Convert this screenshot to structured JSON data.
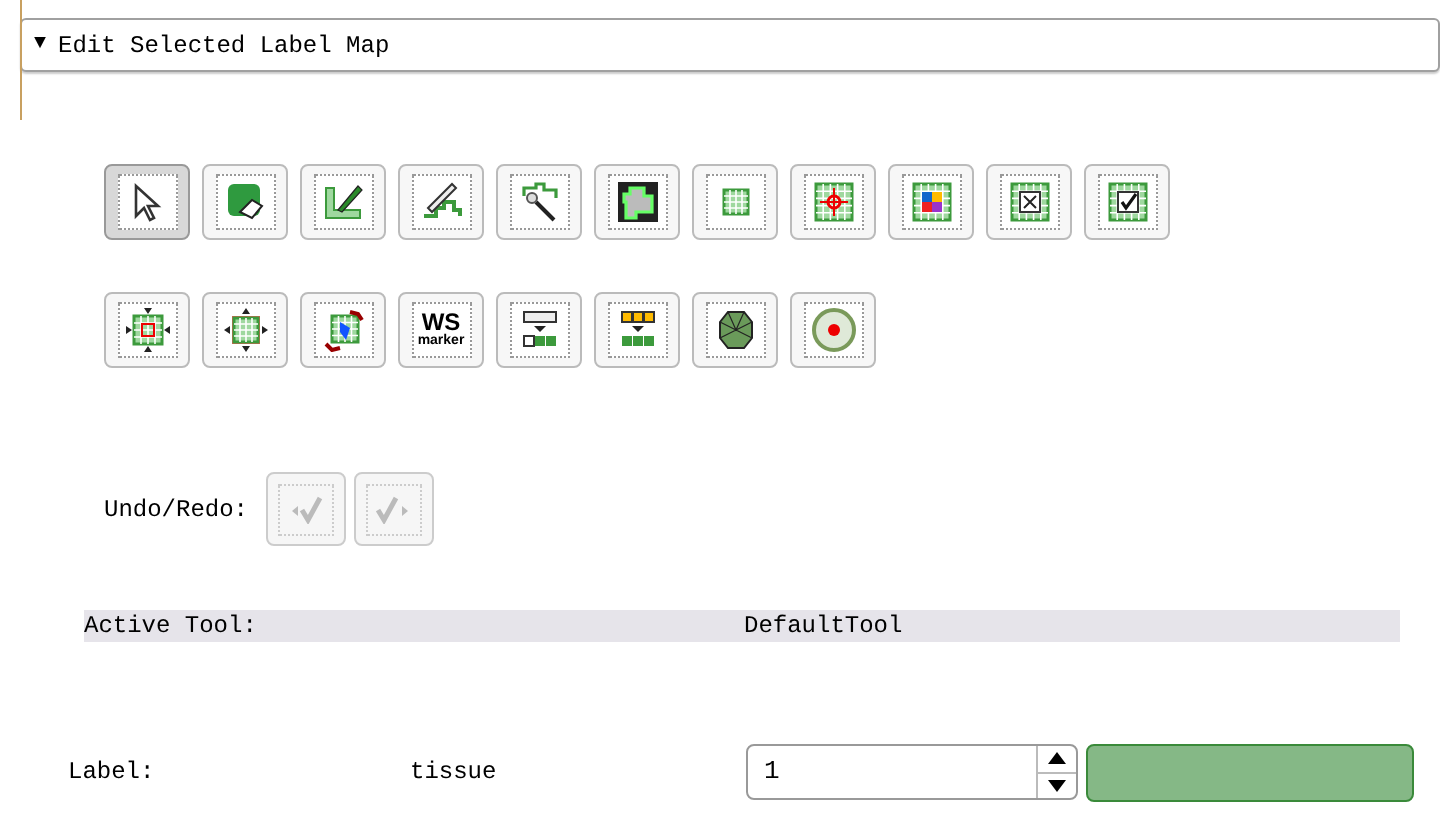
{
  "section": {
    "title": "Edit Selected Label Map",
    "expanded": true,
    "toggle": "▼"
  },
  "tool_rows": [
    [
      {
        "kind": "arrow",
        "selected": true
      },
      {
        "kind": "eraser",
        "selected": false
      },
      {
        "kind": "paint",
        "selected": false
      },
      {
        "kind": "draw",
        "selected": false
      },
      {
        "kind": "wand",
        "selected": false
      },
      {
        "kind": "outline",
        "selected": false
      },
      {
        "kind": "square",
        "selected": false
      },
      {
        "kind": "target",
        "selected": false
      },
      {
        "kind": "colors",
        "selected": false
      },
      {
        "kind": "cross",
        "selected": false
      },
      {
        "kind": "check",
        "selected": false
      }
    ],
    [
      {
        "kind": "shrink",
        "selected": false
      },
      {
        "kind": "grow",
        "selected": false
      },
      {
        "kind": "transfer",
        "selected": false
      },
      {
        "kind": "text",
        "label": "WS",
        "sublabel": "marker",
        "selected": false
      },
      {
        "kind": "merge",
        "selected": false
      },
      {
        "kind": "merge_yellow",
        "selected": false
      },
      {
        "kind": "gem",
        "selected": false
      },
      {
        "kind": "dot",
        "selected": false
      }
    ]
  ],
  "undo_redo": {
    "label": "Undo/Redo:",
    "undo": {
      "disabled": true
    },
    "redo": {
      "disabled": true
    }
  },
  "active_tool": {
    "label": "Active Tool:",
    "value": "DefaultTool"
  },
  "label_row": {
    "label": "Label:",
    "name": "tissue",
    "value": "1",
    "color": "#85b886"
  }
}
